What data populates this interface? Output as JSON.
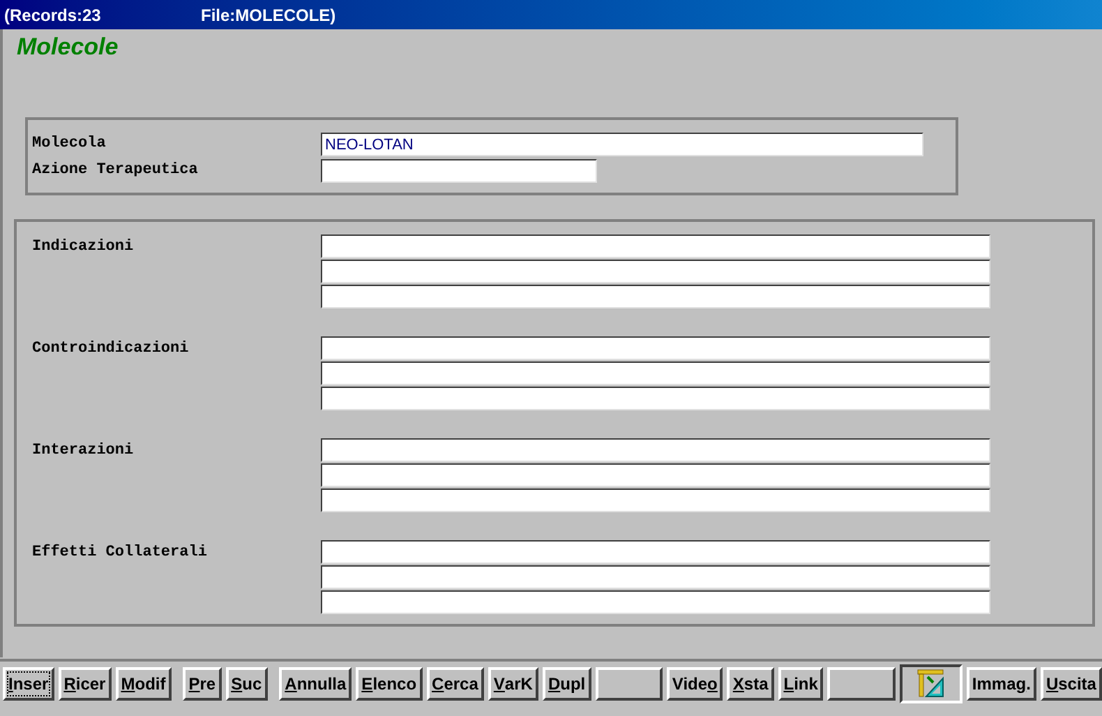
{
  "window": {
    "title_records": "(Records:23",
    "title_file": "File:MOLECOLE)"
  },
  "form_title": "Molecole",
  "header_group": {
    "fields": [
      {
        "label": "Molecola",
        "value": "NEO-LOTAN",
        "kind": "long"
      },
      {
        "label": "Azione Terapeutica",
        "kind": "short"
      }
    ]
  },
  "detail_group": {
    "sections": [
      {
        "label": "Indicazioni"
      },
      {
        "label": "Controindicazioni"
      },
      {
        "label": "Interazioni"
      },
      {
        "label": "Effetti Collaterali"
      }
    ]
  },
  "toolbar": [
    {
      "kind": "text",
      "key": "I",
      "after": "nser",
      "focused": true
    },
    {
      "kind": "text",
      "key": "R",
      "after": "icer",
      "focused": false
    },
    {
      "kind": "text",
      "key": "M",
      "after": "odif",
      "focused": false
    },
    {
      "kind": "gap"
    },
    {
      "kind": "text",
      "key": "P",
      "after": "re",
      "focused": false
    },
    {
      "kind": "text",
      "key": "S",
      "after": "uc",
      "focused": false
    },
    {
      "kind": "gap"
    },
    {
      "kind": "text",
      "key": "A",
      "after": "nnulla",
      "focused": false
    },
    {
      "kind": "text",
      "key": "E",
      "after": "lenco",
      "focused": false
    },
    {
      "kind": "text",
      "key": "C",
      "after": "erca",
      "focused": false
    },
    {
      "kind": "text",
      "key": "V",
      "after": "arK",
      "focused": false
    },
    {
      "kind": "text",
      "key": "D",
      "after": "upl",
      "focused": false
    },
    {
      "kind": "blank"
    },
    {
      "kind": "text",
      "before": "Vide",
      "key": "o",
      "focused": false
    },
    {
      "kind": "text",
      "key": "X",
      "after": "sta",
      "focused": false
    },
    {
      "kind": "text",
      "key": "L",
      "after": "ink",
      "focused": false
    },
    {
      "kind": "blank"
    },
    {
      "kind": "icon"
    },
    {
      "kind": "text",
      "before": "Imma",
      "key": "g",
      "after": ".",
      "focused": false
    },
    {
      "kind": "text",
      "key": "U",
      "after": "scita",
      "focused": false
    }
  ]
}
